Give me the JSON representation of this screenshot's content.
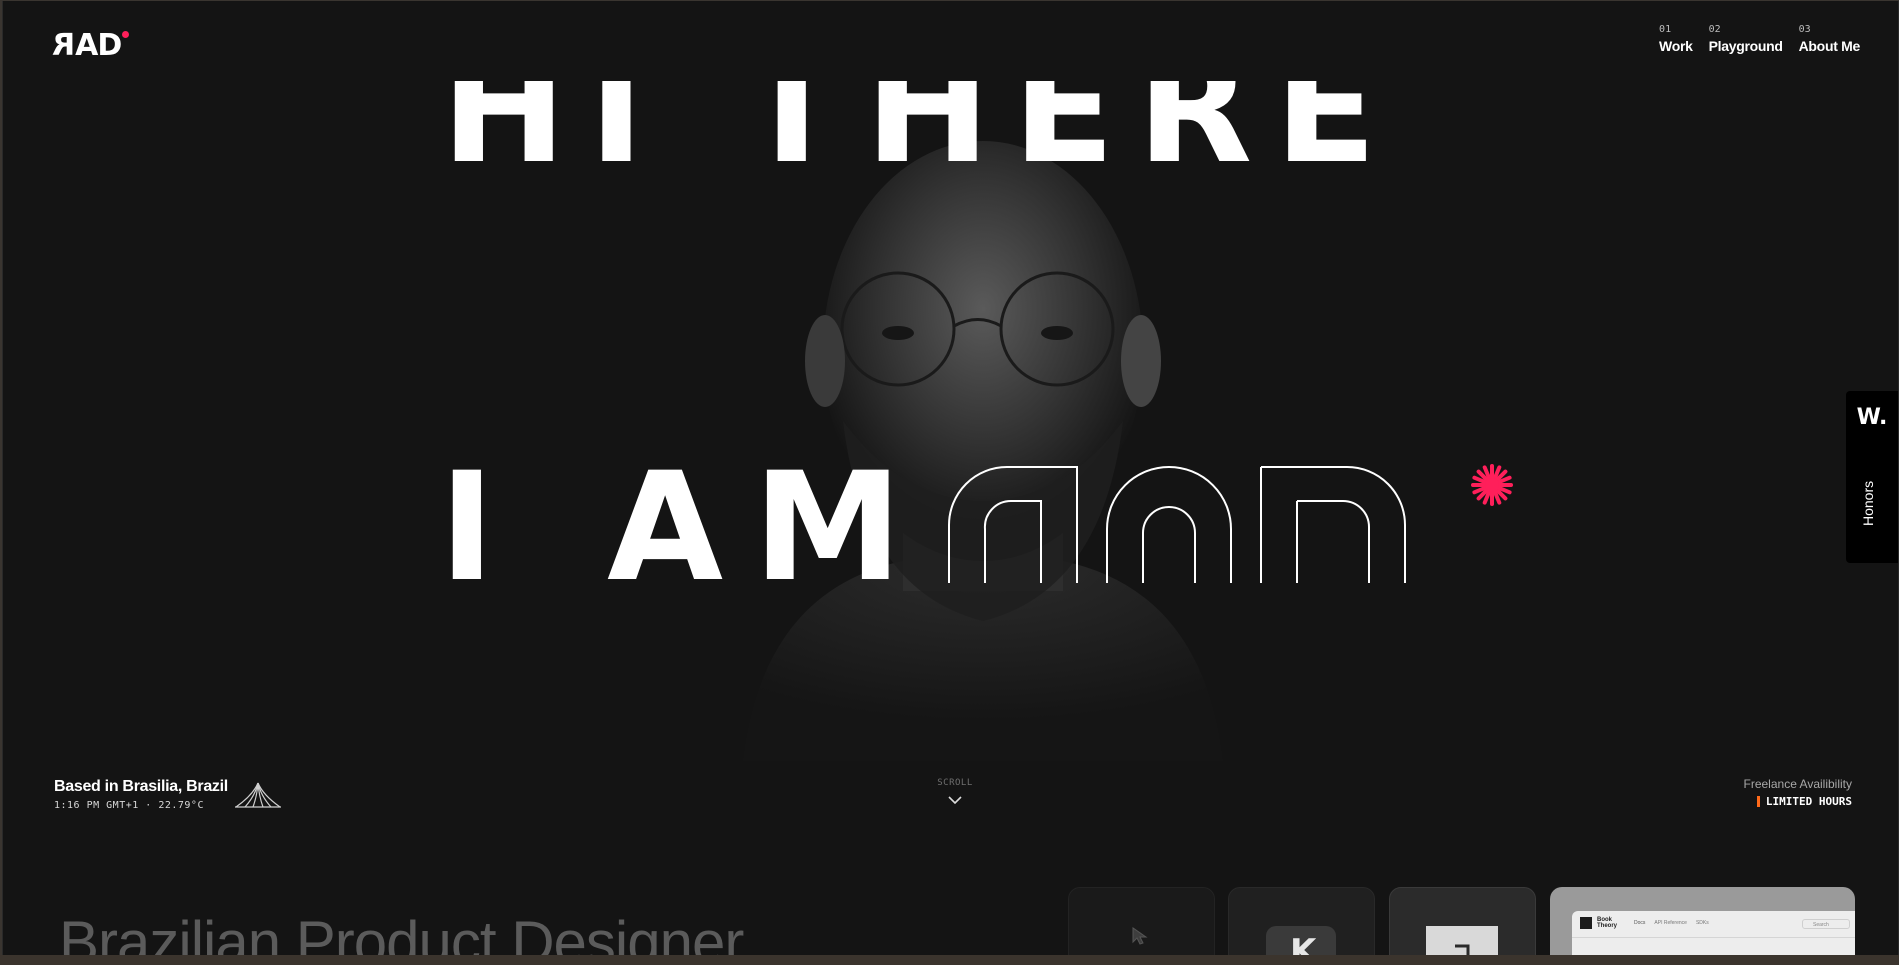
{
  "header": {
    "logo_text": "RAD",
    "logo_flipped_letter": "R",
    "logo_rest": "AD",
    "nav": [
      {
        "num": "01",
        "label": "Work"
      },
      {
        "num": "02",
        "label": "Playground"
      },
      {
        "num": "03",
        "label": "About Me"
      }
    ]
  },
  "hero": {
    "line1": "HI THERE",
    "line2_solid": "I AM",
    "line2_outline": "RAD"
  },
  "honors": {
    "badge": "W.",
    "label": "Honors"
  },
  "location": {
    "title": "Based in Brasilia, Brazil",
    "meta": "1:16 PM GMT+1 · 22.79°C"
  },
  "scroll": {
    "label": "SCROLL"
  },
  "availability": {
    "title": "Freelance Availibility",
    "status": "LIMITED HOURS"
  },
  "next_section": {
    "title": "Brazilian Product Designer",
    "card4_app": "Book Theory",
    "card4_tabs": [
      "Docs",
      "API Reference",
      "SDKs"
    ],
    "card4_search": "Search",
    "card2_letter": "K"
  },
  "colors": {
    "accent": "#ff1f5a",
    "status": "#ff6a1a",
    "background": "#141414"
  },
  "icons": {
    "logo_dot": "accent-dot",
    "asterisk": "asterisk-icon",
    "scroll": "chevron-down-icon",
    "landmark": "cathedral-icon",
    "cursor": "cursor-icon"
  }
}
